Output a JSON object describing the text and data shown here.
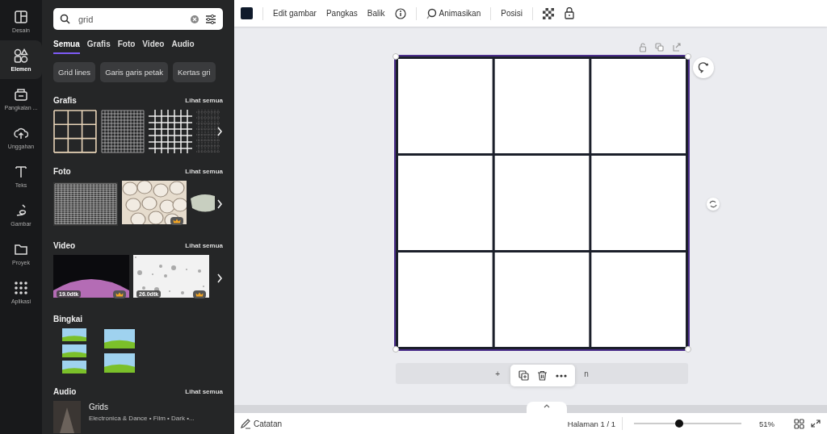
{
  "rail": [
    {
      "label": "Desain",
      "selected": false
    },
    {
      "label": "Elemen",
      "selected": true
    },
    {
      "label": "Pangkalan ...",
      "selected": false
    },
    {
      "label": "Unggahan",
      "selected": false
    },
    {
      "label": "Teks",
      "selected": false
    },
    {
      "label": "Gambar",
      "selected": false
    },
    {
      "label": "Proyek",
      "selected": false
    },
    {
      "label": "Aplikasi",
      "selected": false
    }
  ],
  "search": {
    "value": "grid"
  },
  "filter_tabs": [
    {
      "label": "Semua",
      "selected": true
    },
    {
      "label": "Grafis",
      "selected": false
    },
    {
      "label": "Foto",
      "selected": false
    },
    {
      "label": "Video",
      "selected": false
    },
    {
      "label": "Audio",
      "selected": false
    }
  ],
  "suggestions": [
    "Grid lines",
    "Garis garis petak",
    "Kertas gri"
  ],
  "sections": [
    {
      "kind": "graphics",
      "title": "Grafis",
      "link": "Lihat semua"
    },
    {
      "kind": "photos",
      "title": "Foto",
      "link": "Lihat semua"
    },
    {
      "kind": "videos",
      "title": "Video",
      "link": "Lihat semua",
      "durations": [
        "19.0dtk",
        "26.0dtk"
      ]
    },
    {
      "kind": "frames",
      "title": "Bingkai"
    },
    {
      "kind": "audio",
      "title": "Audio",
      "link": "Lihat semua",
      "track": {
        "title": "Grids",
        "meta": "Electronica & Dance • Film • Dark •..."
      }
    }
  ],
  "toolbar": {
    "items": [
      "Edit gambar",
      "Pangkas",
      "Balik"
    ],
    "animate": "Animasikan",
    "position": "Posisi"
  },
  "canvas": {
    "selected": true
  },
  "add_page": {
    "left": "+",
    "right": "n"
  },
  "bottom_bar": {
    "notes": "Catatan",
    "page": "Halaman 1 / 1",
    "zoom": {
      "level": 0.42,
      "reading": "51%"
    }
  }
}
